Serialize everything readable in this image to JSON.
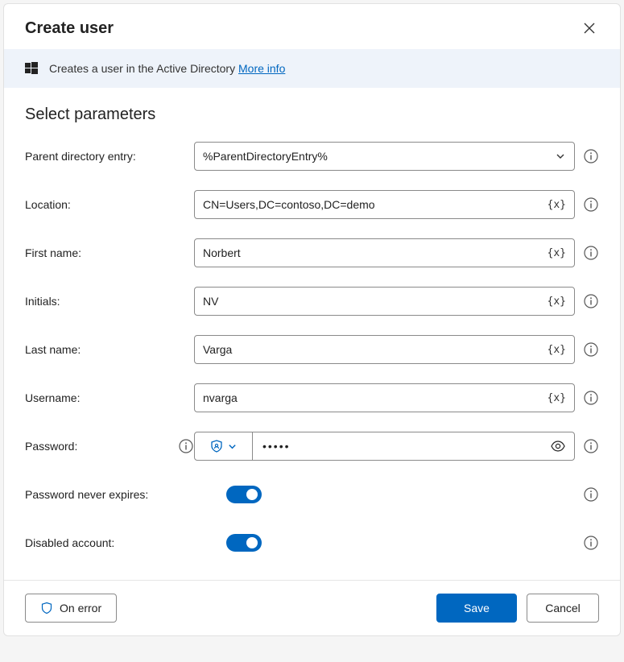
{
  "header": {
    "title": "Create user"
  },
  "banner": {
    "text": "Creates a user in the Active Directory",
    "more": "More info"
  },
  "section_title": "Select parameters",
  "fields": {
    "parent_entry": {
      "label": "Parent directory entry:",
      "value": "%ParentDirectoryEntry%"
    },
    "location": {
      "label": "Location:",
      "value": "CN=Users,DC=contoso,DC=demo"
    },
    "first_name": {
      "label": "First name:",
      "value": "Norbert"
    },
    "initials": {
      "label": "Initials:",
      "value": "NV"
    },
    "last_name": {
      "label": "Last name:",
      "value": "Varga"
    },
    "username": {
      "label": "Username:",
      "value": "nvarga"
    },
    "password": {
      "label": "Password:",
      "value": "•••••"
    },
    "pwd_never_expires": {
      "label": "Password never expires:",
      "on": true
    },
    "disabled_account": {
      "label": "Disabled account:",
      "on": true
    }
  },
  "variable_token": "{x}",
  "footer": {
    "on_error": "On error",
    "save": "Save",
    "cancel": "Cancel"
  }
}
